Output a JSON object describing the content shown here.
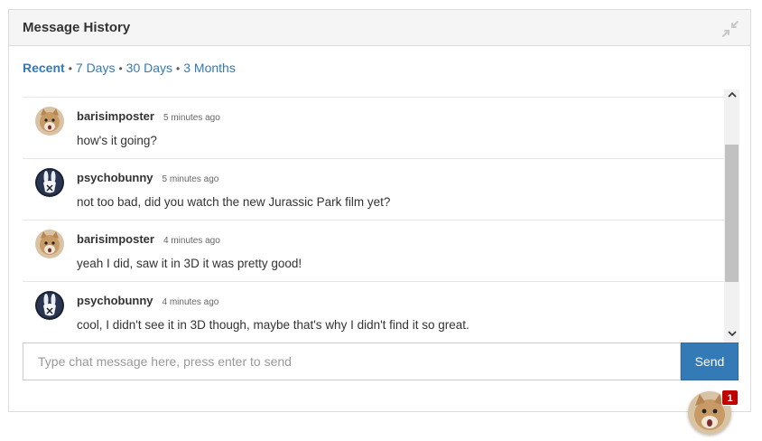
{
  "panel": {
    "title": "Message History"
  },
  "filters": [
    {
      "label": "Recent",
      "active": true
    },
    {
      "label": "7 Days",
      "active": false
    },
    {
      "label": "30 Days",
      "active": false
    },
    {
      "label": "3 Months",
      "active": false
    }
  ],
  "messages": [
    {
      "user": "barisimposter",
      "time": "5 minutes ago",
      "text": "how's it going?",
      "avatar": "cat-avatar"
    },
    {
      "user": "psychobunny",
      "time": "5 minutes ago",
      "text": "not too bad, did you watch the new Jurassic Park film yet?",
      "avatar": "bunny-avatar"
    },
    {
      "user": "barisimposter",
      "time": "4 minutes ago",
      "text": "yeah I did, saw it in 3D it was pretty good!",
      "avatar": "cat-avatar"
    },
    {
      "user": "psychobunny",
      "time": "4 minutes ago",
      "text": "cool, I didn't see it in 3D though, maybe that's why I didn't find it so great.",
      "avatar": "bunny-avatar"
    }
  ],
  "composer": {
    "placeholder": "Type chat message here, press enter to send",
    "send_label": "Send"
  },
  "floating_chat": {
    "badge_count": "1"
  },
  "colors": {
    "accent": "#337ab7",
    "badge": "#c00000",
    "header_bg": "#f5f5f5"
  }
}
